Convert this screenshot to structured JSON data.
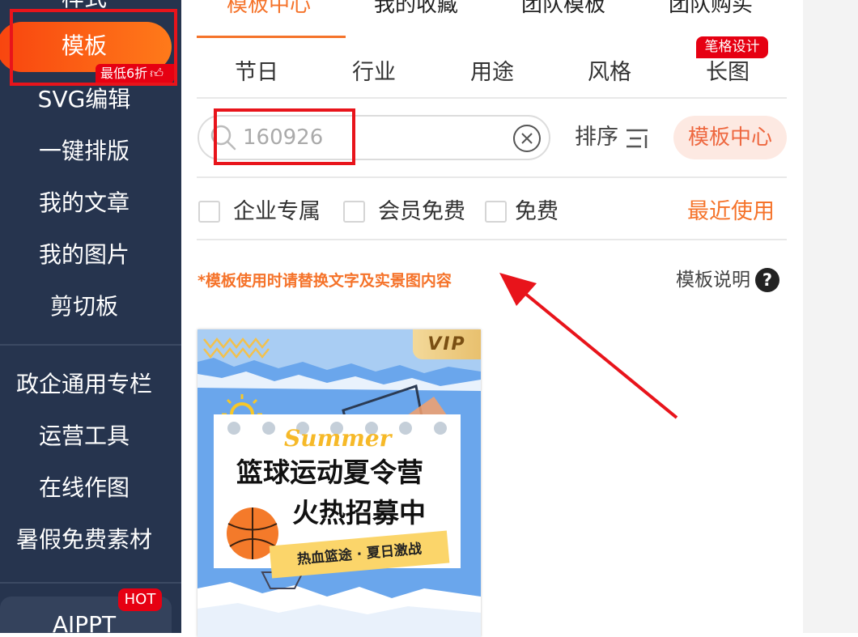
{
  "sidebar": {
    "top_partial": "样式",
    "active_item": "模板",
    "discount_badge": "最低6折",
    "items": [
      "SVG编辑",
      "一键排版",
      "我的文章",
      "我的图片",
      "剪切板"
    ],
    "items2": [
      "政企通用专栏",
      "运营工具",
      "在线作图",
      "暑假免费素材"
    ],
    "aippt": "AIPPT",
    "hot_badge": "HOT"
  },
  "tabs": [
    "模板中心",
    "我的收藏",
    "团队模板",
    "团队购买"
  ],
  "categories": [
    "节日",
    "行业",
    "用途",
    "风格",
    "长图"
  ],
  "category_badge": "笔格设计",
  "search": {
    "value": "160926",
    "placeholder": "160926"
  },
  "sort_label": "排序",
  "center_button": "模板中心",
  "filters": [
    "企业专属",
    "会员免费",
    "免费"
  ],
  "recent_label": "最近使用",
  "notice": "*模板使用时请替换文字及实景图内容",
  "help_label": "模板说明",
  "help_icon_glyph": "?",
  "card": {
    "vip": "VIP",
    "summer": "Summer",
    "title_line1": "篮球运动夏令营",
    "title_line2": "火热招募中",
    "ribbon": "热血篮途 · 夏日激战"
  },
  "colors": {
    "sidebar_bg": "#26344e",
    "accent_orange": "#f5732a",
    "highlight_red": "#e8141b",
    "badge_red": "#e60012"
  }
}
